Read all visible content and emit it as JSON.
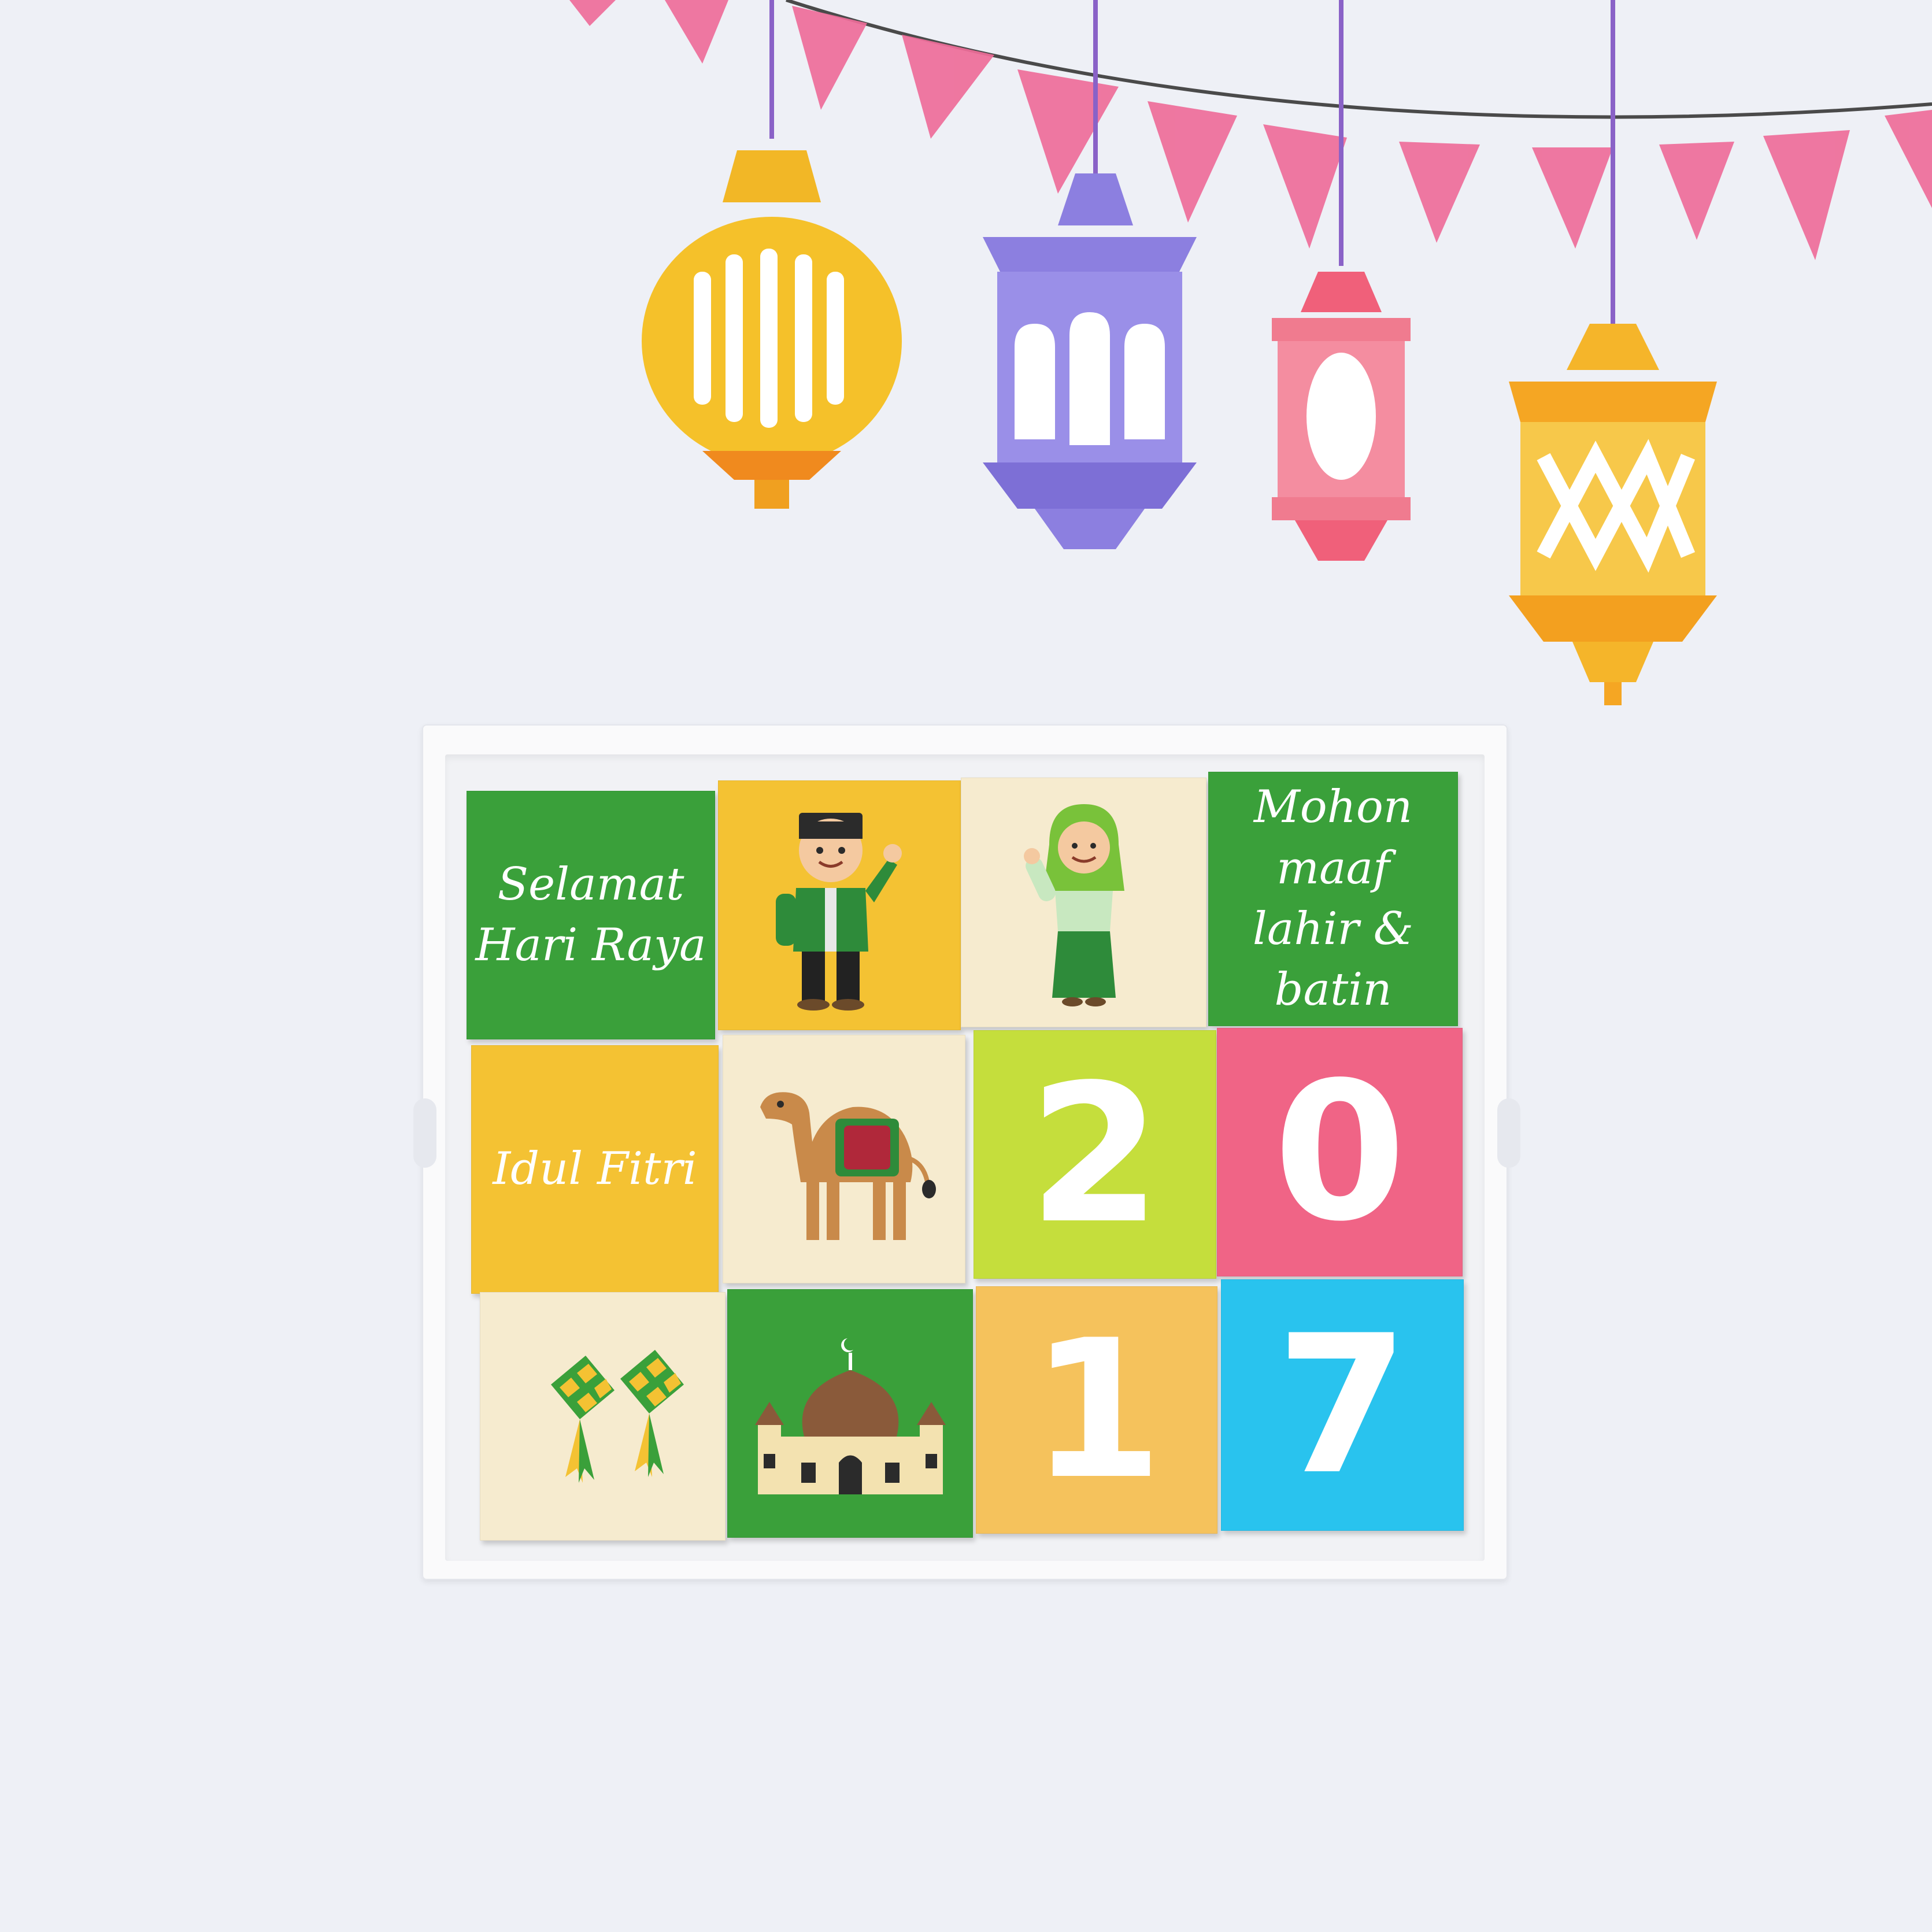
{
  "colors": {
    "background": "#eef0f6",
    "green": "#3aa03a",
    "yellow": "#f4c233",
    "cream": "#f6ebcf",
    "lime": "#c5de3c",
    "pink": "#f06486",
    "orange": "#f5c25c",
    "cyan": "#29c3ee"
  },
  "decorations": {
    "bunting": "pink-bunting-garland",
    "lanterns": [
      "yellow-round-lantern",
      "purple-lantern",
      "pink-lantern",
      "orange-lantern"
    ]
  },
  "tiles": {
    "greeting_1": "Selamat\nHari Raya",
    "greeting_2": "Mohon maaf\nlahir & batin",
    "greeting_3": "Idul Fitri",
    "digit_1": "2",
    "digit_2": "0",
    "digit_3": "1",
    "digit_4": "7",
    "icons": [
      "boy-icon",
      "girl-icon",
      "camel-icon",
      "ketupat-icon",
      "mosque-icon"
    ]
  }
}
